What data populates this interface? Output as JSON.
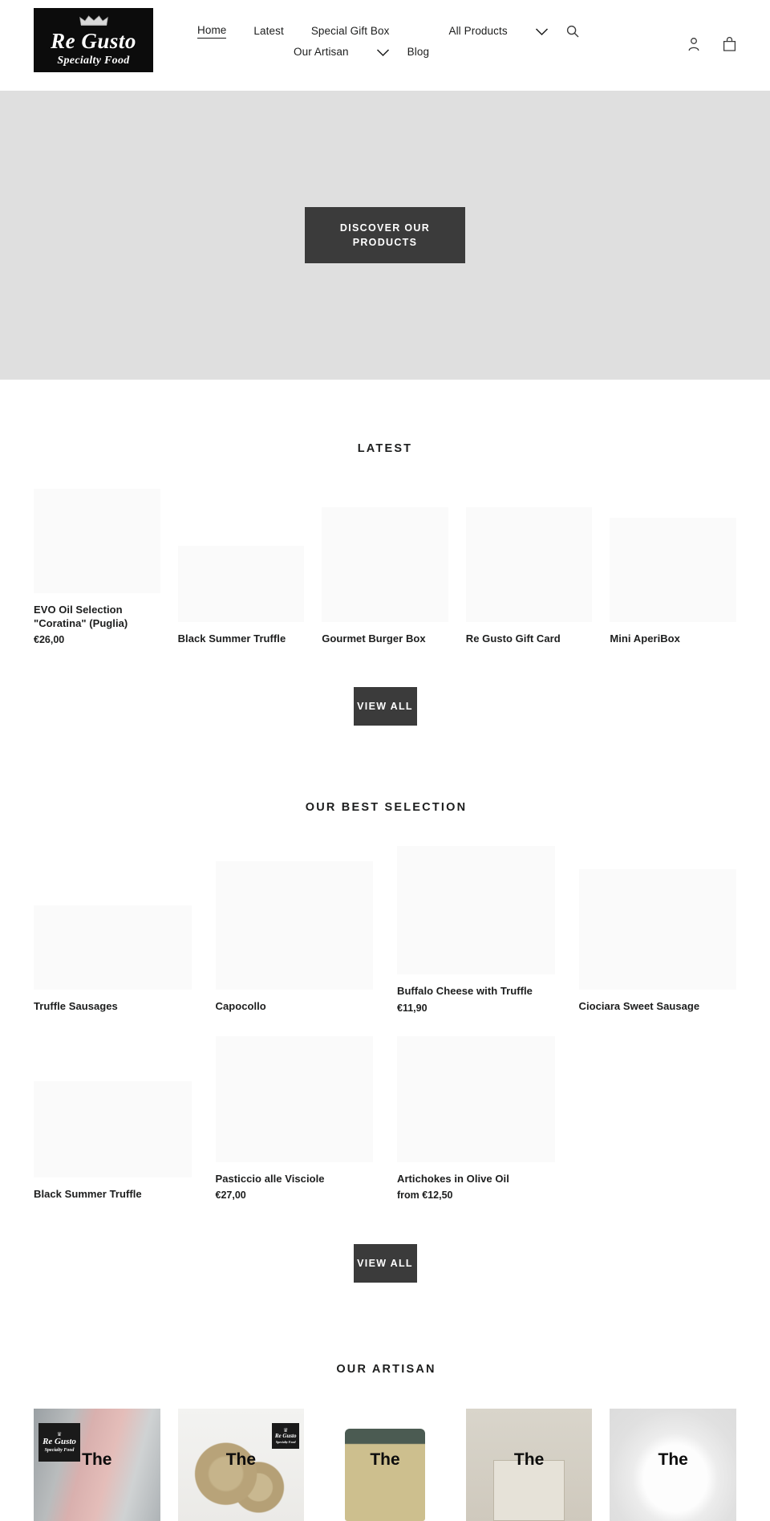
{
  "brand": {
    "crown_icon": "crown-icon",
    "name": "Re Gusto",
    "tagline": "Specialty Food"
  },
  "nav": {
    "row1": [
      {
        "label": "Home",
        "active": true
      },
      {
        "label": "Latest",
        "active": false
      },
      {
        "label": "Special Gift Box",
        "active": false
      },
      {
        "label": "All Products",
        "active": false
      }
    ],
    "row2": [
      {
        "label": "Our Artisan",
        "active": false
      },
      {
        "label": "Blog",
        "active": false
      }
    ],
    "chevron_icon": "chevron-down-icon",
    "search_icon": "search-icon"
  },
  "header_actions": {
    "account_icon": "account-icon",
    "cart_icon": "cart-icon"
  },
  "hero": {
    "cta_label": "DISCOVER OUR PRODUCTS",
    "background_color": "#dfdfdf"
  },
  "latest": {
    "title": "LATEST",
    "view_all_label": "VIEW ALL",
    "products": [
      {
        "title": "EVO Oil Selection \"Coratina\" (Puglia)",
        "price": "€26,00",
        "media_h": 130,
        "offset": 0
      },
      {
        "title": "Black Summer Truffle",
        "price": "",
        "media_h": 95,
        "offset": 0
      },
      {
        "title": "Gourmet Burger Box",
        "price": "",
        "media_h": 143,
        "offset": 0
      },
      {
        "title": "Re  Gusto Gift Card",
        "price": "",
        "media_h": 143,
        "offset": 0
      },
      {
        "title": "Mini AperiBox",
        "price": "",
        "media_h": 130,
        "offset": 0
      }
    ]
  },
  "best_selection": {
    "title": "OUR BEST SELECTION",
    "view_all_label": "VIEW ALL",
    "row1": [
      {
        "title": "Truffle Sausages",
        "price": "",
        "media_h": 105
      },
      {
        "title": "Capocollo",
        "price": "",
        "media_h": 160
      },
      {
        "title": "Buffalo Cheese with Truffle",
        "price": "€11,90",
        "media_h": 160
      },
      {
        "title": "Ciociara Sweet Sausage",
        "price": "",
        "media_h": 150
      }
    ],
    "row2": [
      {
        "title": "Black Summer Truffle",
        "price": "",
        "media_h": 120
      },
      {
        "title": "Pasticcio alle Visciole",
        "price": "€27,00",
        "media_h": 157
      },
      {
        "title": "Artichokes in Olive Oil",
        "price": "from €12,50",
        "media_h": 157
      }
    ]
  },
  "artisan": {
    "title": "OUR ARTISAN",
    "cards": [
      {
        "label": "The",
        "photo": "photo-a",
        "has_mini_logo": true
      },
      {
        "label": "The",
        "photo": "photo-b",
        "has_mini_logo": true
      },
      {
        "label": "The",
        "photo": "photo-c",
        "has_mini_logo": false
      },
      {
        "label": "The",
        "photo": "photo-d",
        "has_mini_logo": false
      },
      {
        "label": "The",
        "photo": "photo-e",
        "has_mini_logo": false
      }
    ]
  },
  "colors": {
    "text": "#1c1d1d",
    "button_dark": "#3b3b3b",
    "hero_bg": "#dfdfdf",
    "card_placeholder": "#fafafa",
    "logo_bg": "#0c0c0c"
  }
}
